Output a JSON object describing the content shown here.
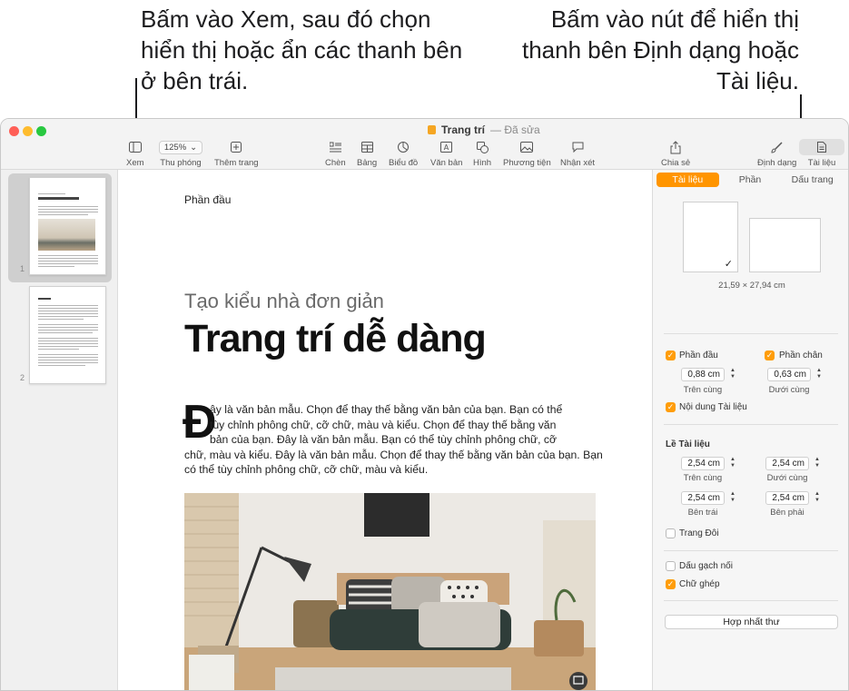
{
  "callouts": {
    "left": "Bấm vào Xem, sau đó chọn hiển thị hoặc ẩn các thanh bên ở bên trái.",
    "right": "Bấm vào nút để hiển thị thanh bên Định dạng hoặc Tài liệu."
  },
  "window": {
    "title": "Trang trí",
    "edited_label": "— Đã sửa"
  },
  "toolbar": {
    "view_label": "Xem",
    "zoom_value": "125%",
    "zoom_label": "Thu phóng",
    "add_page_label": "Thêm trang",
    "insert_label": "Chèn",
    "table_label": "Bảng",
    "chart_label": "Biểu đồ",
    "text_label": "Văn bản",
    "shape_label": "Hình",
    "media_label": "Phương tiện",
    "comment_label": "Nhận xét",
    "share_label": "Chia sẻ",
    "format_label": "Định dạng",
    "document_label": "Tài liệu"
  },
  "thumbnails": {
    "page1_number": "1",
    "page2_number": "2"
  },
  "document": {
    "header": "Phần đầu",
    "subtitle": "Tạo kiểu nhà đơn giản",
    "title": "Trang trí dễ dàng",
    "drop_cap": "Đ",
    "body_first": "ây là văn bản mẫu. Chọn để thay thế bằng văn bản của bạn. Bạn có thể",
    "body_second": "tùy chỉnh phông chữ, cỡ chữ, màu và kiểu. Chọn để thay thế bằng văn",
    "body_third": "bản của bạn. Đây là văn bản mẫu. Bạn có thể tùy chỉnh phông chữ, cỡ",
    "body_rest": "chữ, màu và kiểu. Đây là văn bản mẫu. Chọn để thay thế bằng văn bản của bạn. Bạn có thể tùy chỉnh phông chữ, cỡ chữ, màu và kiểu."
  },
  "inspector": {
    "tabs": [
      "Tài liệu",
      "Phần",
      "Dấu trang"
    ],
    "paper_size": "21,59 × 27,94 cm",
    "header_label": "Phần đầu",
    "footer_label": "Phần chân",
    "header_value": "0,88 cm",
    "footer_value": "0,63 cm",
    "top_label": "Trên cùng",
    "bottom_label": "Dưới cùng",
    "body_label": "Nội dung Tài liệu",
    "margins_title": "Lề Tài liệu",
    "margin_top": "2,54 cm",
    "margin_bottom": "2,54 cm",
    "margin_left": "2,54 cm",
    "margin_right": "2,54 cm",
    "margin_top_label": "Trên cùng",
    "margin_bottom_label": "Dưới cùng",
    "margin_left_label": "Bên trái",
    "margin_right_label": "Bên phải",
    "facing_pages": "Trang Đôi",
    "hyphenation": "Dấu gạch nối",
    "ligatures": "Chữ ghép",
    "mail_merge": "Hợp nhất thư"
  },
  "colors": {
    "accent": "#ff9500",
    "close": "#ff5f57",
    "minimize": "#febc2e",
    "zoom": "#28c840"
  }
}
